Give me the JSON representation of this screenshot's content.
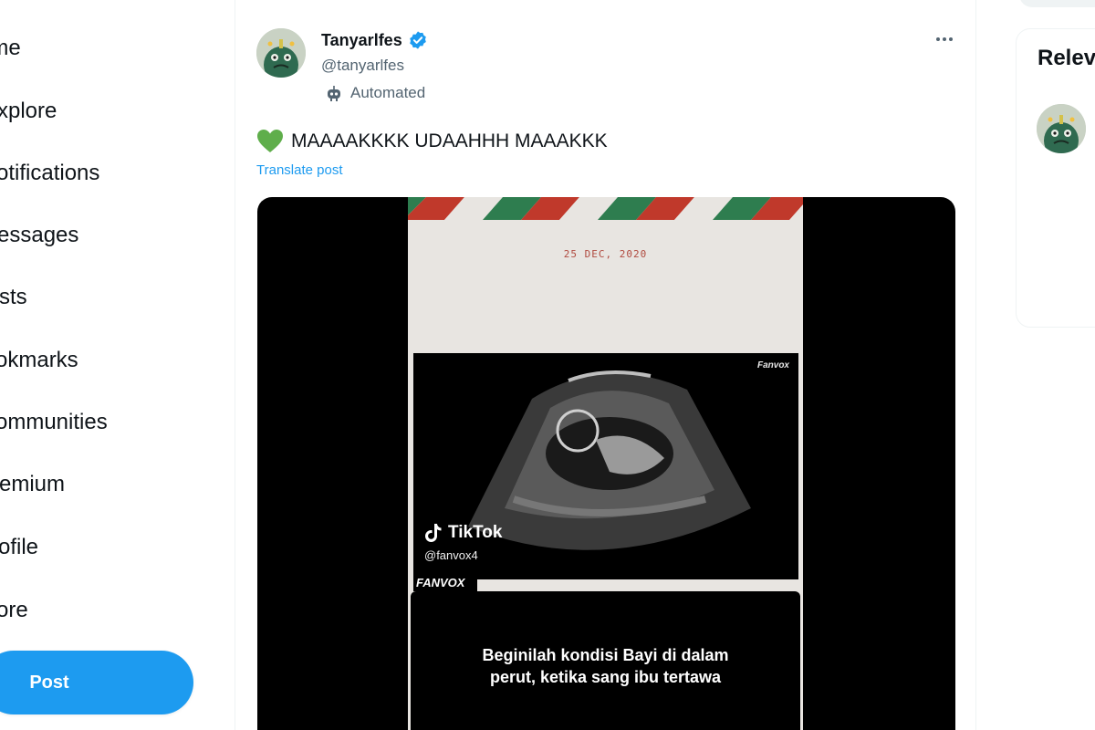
{
  "nav": {
    "items": [
      {
        "label": "ome"
      },
      {
        "label": "xplore"
      },
      {
        "label": "otifications"
      },
      {
        "label": "essages"
      },
      {
        "label": "sts"
      },
      {
        "label": "okmarks"
      },
      {
        "label": "ommunities"
      },
      {
        "label": "emium"
      },
      {
        "label": "ofile"
      },
      {
        "label": "ore"
      }
    ],
    "post_label": "Post"
  },
  "tweet": {
    "author_name": "Tanyarlfes",
    "handle": "@tanyarlfes",
    "automated_label": "Automated",
    "text": "MAAAAKKKK UDAAHHH MAAAKKK",
    "translate_label": "Translate post",
    "media": {
      "date": "25 DEC, 2020",
      "watermark_top": "Fanvox",
      "tiktok_label": "TikTok",
      "tiktok_handle": "@fanvox4",
      "fanvox_label": "FANVOX",
      "caption_line1": "Beginilah kondisi Bayi di dalam",
      "caption_line2": "perut, ketika sang ibu tertawa"
    }
  },
  "right": {
    "relevant_title": "Relev"
  },
  "colors": {
    "accent": "#1d9bf0",
    "secondary_text": "#536471",
    "heart": "#5fae4b"
  }
}
